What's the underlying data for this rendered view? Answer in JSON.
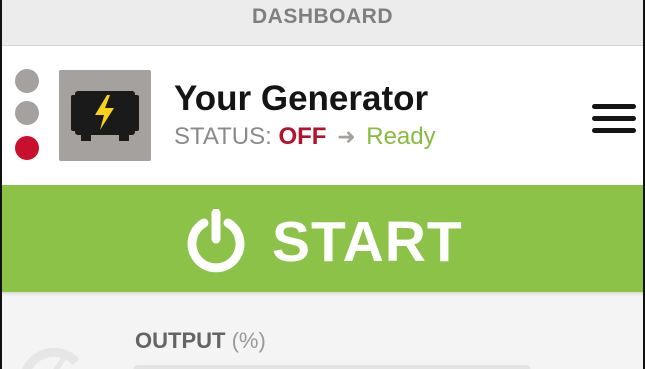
{
  "title_bar": {
    "title": "DASHBOARD"
  },
  "header": {
    "generator_name": "Your Generator",
    "status": {
      "label": "STATUS:",
      "current": "OFF",
      "arrow_icon": "arrow-right-icon",
      "next": "Ready"
    },
    "indicator_dots": [
      "gray",
      "gray",
      "red"
    ],
    "menu_icon": "hamburger-icon"
  },
  "start_button": {
    "label": "START",
    "icon": "power-icon"
  },
  "output": {
    "label": "OUTPUT",
    "unit": "(%)"
  },
  "colors": {
    "accent_green": "#8dc249",
    "status_red": "#b3122e",
    "ready_green": "#86bd3f",
    "tile_gray": "#a4a19f"
  }
}
